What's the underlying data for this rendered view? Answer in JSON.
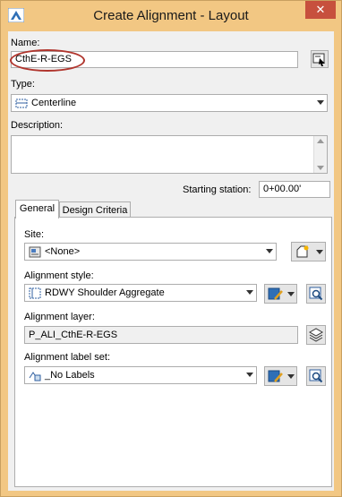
{
  "window": {
    "title": "Create Alignment - Layout",
    "close_label": "✕"
  },
  "name": {
    "label": "Name:",
    "value": "CthE-R-EGS"
  },
  "type": {
    "label": "Type:",
    "value": "Centerline"
  },
  "description": {
    "label": "Description:",
    "value": ""
  },
  "starting_station": {
    "label": "Starting station:",
    "value": "0+00.00'"
  },
  "tabs": [
    {
      "label": "General"
    },
    {
      "label": "Design Criteria"
    }
  ],
  "site": {
    "label": "Site:",
    "value": "<None>"
  },
  "alignment_style": {
    "label": "Alignment style:",
    "value": "RDWY Shoulder Aggregate"
  },
  "alignment_layer": {
    "label": "Alignment layer:",
    "value": "P_ALI_CthE-R-EGS"
  },
  "alignment_label_set": {
    "label": "Alignment label set:",
    "value": "_No Labels"
  },
  "colors": {
    "titlebar": "#f2c783",
    "close": "#c7503d",
    "highlight": "#b0352d"
  }
}
